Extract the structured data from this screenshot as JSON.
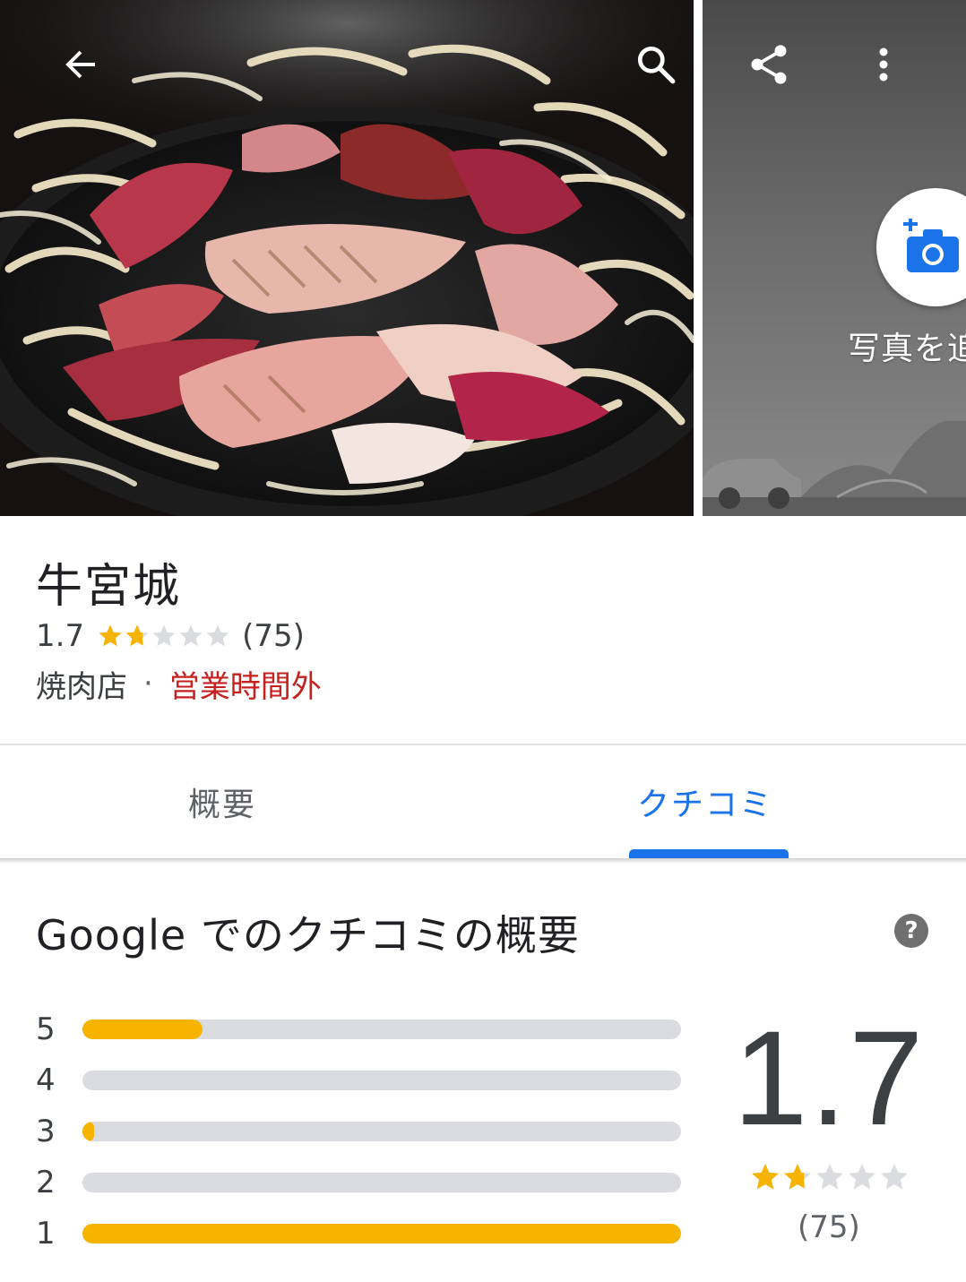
{
  "hero": {
    "icons": {
      "back": "arrow-back-icon",
      "search": "search-icon",
      "share": "share-icon",
      "more": "more-vert-icon",
      "add_photo": "add-photo-camera-icon"
    },
    "add_photo_label": "写真を追"
  },
  "place": {
    "name": "牛宮城",
    "rating": "1.7",
    "rating_value": 1.7,
    "review_count": "(75)",
    "category": "焼肉店",
    "separator": "·",
    "status": "営業時間外",
    "status_color": "#c5221f"
  },
  "tabs": [
    {
      "label": "概要",
      "selected": false
    },
    {
      "label": "クチコミ",
      "selected": true
    }
  ],
  "accent_color": "#1a73e8",
  "star_color": "#f6b400",
  "summary": {
    "title": "Google でのクチコミの概要",
    "help": "?",
    "histogram": [
      {
        "stars": "5",
        "fraction": 0.2
      },
      {
        "stars": "4",
        "fraction": 0.0
      },
      {
        "stars": "3",
        "fraction": 0.02
      },
      {
        "stars": "2",
        "fraction": 0.0
      },
      {
        "stars": "1",
        "fraction": 1.0
      }
    ],
    "average": "1.7",
    "average_value": 1.7,
    "count": "(75)"
  }
}
